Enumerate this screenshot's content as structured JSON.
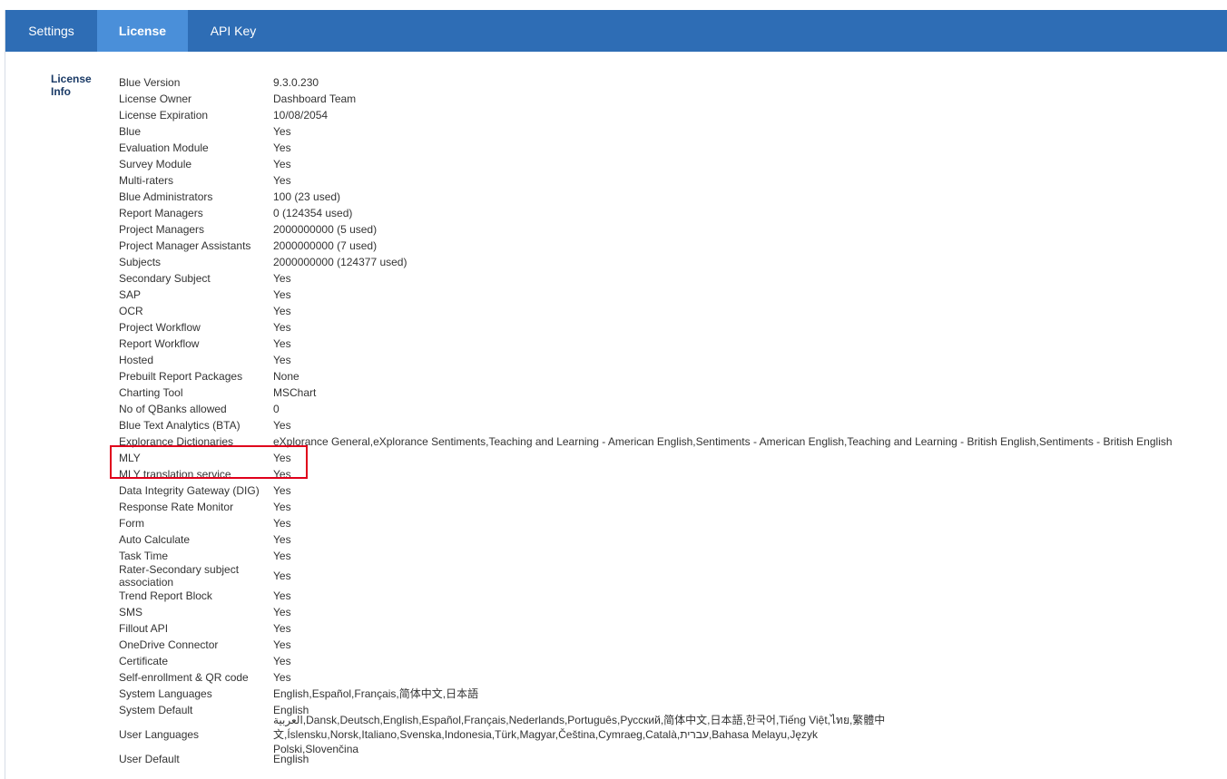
{
  "tabs": [
    {
      "label": "Settings"
    },
    {
      "label": "License"
    },
    {
      "label": "API Key"
    }
  ],
  "section_label": "License Info",
  "license_rows": [
    {
      "key": "Blue Version",
      "value": "9.3.0.230"
    },
    {
      "key": "License Owner",
      "value": "Dashboard Team"
    },
    {
      "key": "License Expiration",
      "value": "10/08/2054"
    },
    {
      "key": "Blue",
      "value": "Yes"
    },
    {
      "key": "Evaluation Module",
      "value": "Yes"
    },
    {
      "key": "Survey Module",
      "value": "Yes"
    },
    {
      "key": "Multi-raters",
      "value": "Yes"
    },
    {
      "key": "Blue Administrators",
      "value": "100  (23 used)"
    },
    {
      "key": "Report Managers",
      "value": "0  (124354 used)"
    },
    {
      "key": "Project Managers",
      "value": "2000000000  (5 used)"
    },
    {
      "key": "Project Manager Assistants",
      "value": "2000000000  (7 used)"
    },
    {
      "key": "Subjects",
      "value": "2000000000  (124377 used)"
    },
    {
      "key": "Secondary Subject",
      "value": "Yes"
    },
    {
      "key": "SAP",
      "value": "Yes"
    },
    {
      "key": "OCR",
      "value": "Yes"
    },
    {
      "key": "Project Workflow",
      "value": "Yes"
    },
    {
      "key": "Report Workflow",
      "value": "Yes"
    },
    {
      "key": "Hosted",
      "value": "Yes"
    },
    {
      "key": "Prebuilt Report Packages",
      "value": "None"
    },
    {
      "key": "Charting Tool",
      "value": "MSChart"
    },
    {
      "key": "No of QBanks allowed",
      "value": "0"
    },
    {
      "key": "Blue Text Analytics (BTA)",
      "value": "Yes"
    },
    {
      "key": "Explorance Dictionaries",
      "value": "eXplorance General,eXplorance Sentiments,Teaching and Learning - American English,Sentiments - American English,Teaching and Learning - British English,Sentiments - British English"
    },
    {
      "key": "MLY",
      "value": "Yes"
    },
    {
      "key": "MLY translation service",
      "value": "Yes"
    },
    {
      "key": "Data Integrity Gateway (DIG)",
      "value": "Yes"
    },
    {
      "key": "Response Rate Monitor",
      "value": "Yes"
    },
    {
      "key": "Form",
      "value": "Yes"
    },
    {
      "key": "Auto Calculate",
      "value": "Yes"
    },
    {
      "key": "Task Time",
      "value": "Yes"
    },
    {
      "key": "Rater-Secondary subject association",
      "value": "Yes"
    },
    {
      "key": "Trend Report Block",
      "value": "Yes"
    },
    {
      "key": "SMS",
      "value": "Yes"
    },
    {
      "key": "Fillout API",
      "value": "Yes"
    },
    {
      "key": "OneDrive Connector",
      "value": "Yes"
    },
    {
      "key": "Certificate",
      "value": "Yes"
    },
    {
      "key": "Self-enrollment & QR code",
      "value": "Yes"
    },
    {
      "key": "System Languages",
      "value": "English,Español,Français,简体中文,日本語"
    },
    {
      "key": "System Default",
      "value": "English"
    },
    {
      "key": "User Languages",
      "value": "العربية,Dansk,Deutsch,English,Español,Français,Nederlands,Português,Русский,简体中文,日本語,한국어,Tiếng Việt,ไทย,繁體中文,Íslensku,Norsk,Italiano,Svenska,Indonesia,Türk,Magyar,Čeština,Cymraeg,Català,עברית,Bahasa Melayu,Język Polski,Slovenčina"
    },
    {
      "key": "User Default",
      "value": "English"
    }
  ],
  "colors": {
    "tabbar": "#2e6db5",
    "active_tab": "#4a8fd9",
    "highlight": "#e0001b"
  }
}
